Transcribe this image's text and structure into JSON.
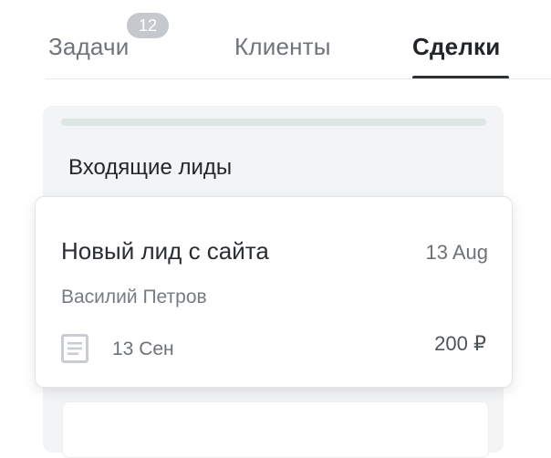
{
  "tabs": {
    "items": [
      {
        "label": "Задачи",
        "badge": "12"
      },
      {
        "label": "Клиенты"
      },
      {
        "label": "Сделки",
        "active": true
      }
    ]
  },
  "column": {
    "title": "Входящие лиды"
  },
  "card": {
    "title": "Новый лид с сайта",
    "date": "13 Aug",
    "contact": "Василий Петров",
    "task_icon": "document-icon",
    "task_date": "13 Сен",
    "amount": "200 ₽"
  },
  "colors": {
    "active_tab": "#22262b",
    "inactive_tab": "#6f747a",
    "badge_bg": "#c5c9cd",
    "column_bg": "#f3f4f6",
    "progress": "#dce6e3"
  }
}
